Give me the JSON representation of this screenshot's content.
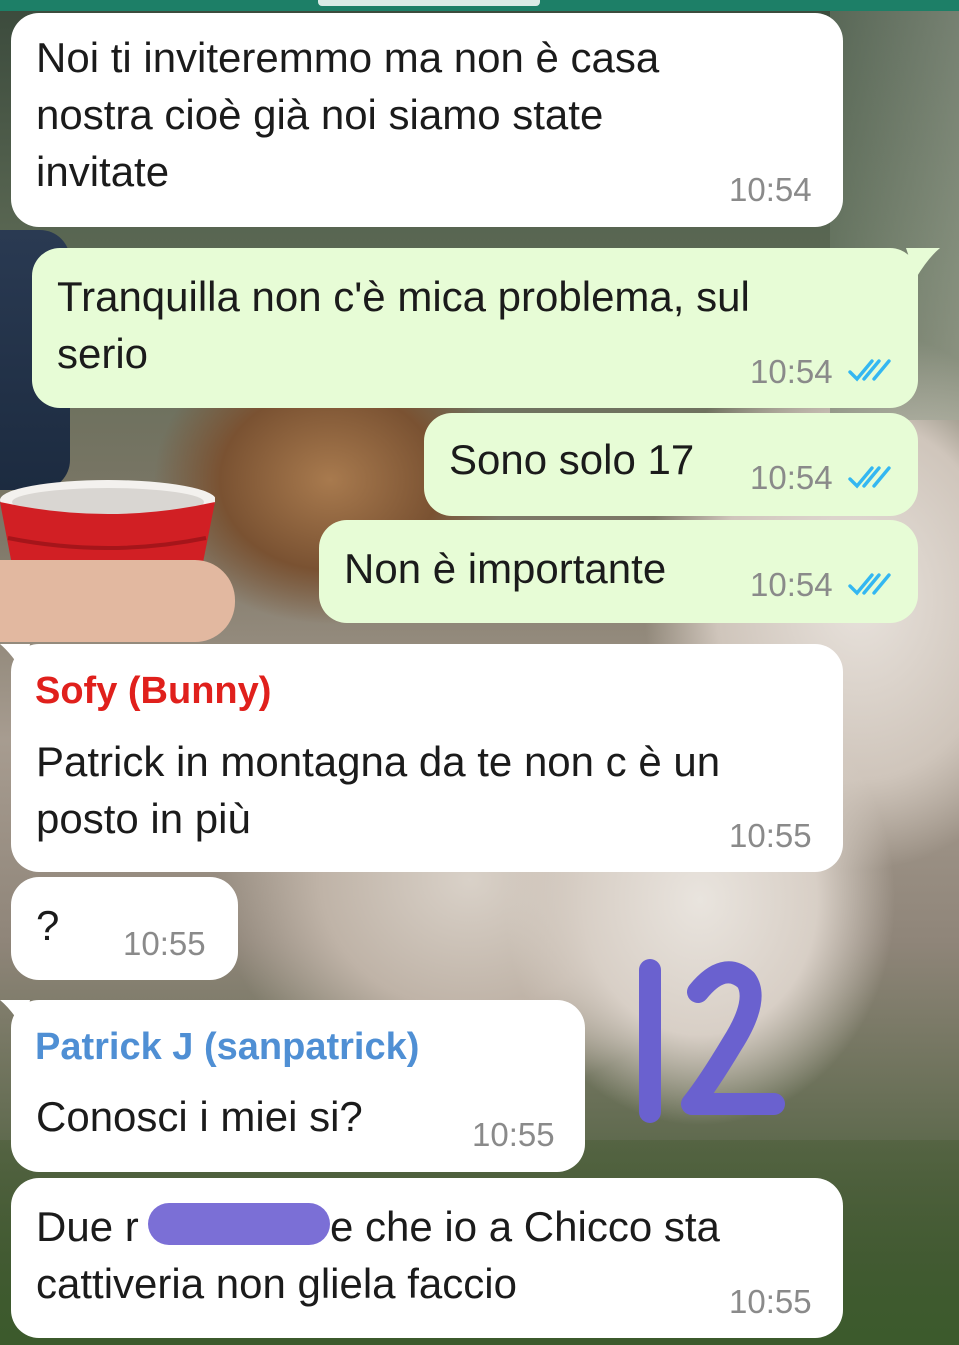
{
  "messages": [
    {
      "text_lines": [
        "Noi ti inviteremmo ma non è casa",
        "nostra cioè già noi siamo state",
        "invitate"
      ],
      "time": "10:54"
    },
    {
      "text_lines": [
        "Tranquilla non c'è mica problema, sul",
        "serio"
      ],
      "time": "10:54"
    },
    {
      "text": "Sono solo 17",
      "time": "10:54"
    },
    {
      "text": "Non è importante",
      "time": "10:54"
    },
    {
      "sender": "Sofy (Bunny)",
      "text_lines": [
        "Patrick in montagna da te non c è un",
        "posto in più"
      ],
      "time": "10:55"
    },
    {
      "text": "?",
      "time": "10:55"
    },
    {
      "sender": "Patrick J (sanpatrick)",
      "text": "Conosci i miei si?",
      "time": "10:55"
    },
    {
      "text_lines": [
        "Due r",
        "e che io a Chicco sta",
        "cattiveria non gliela faccio"
      ],
      "time": "10:55"
    }
  ],
  "annotation": "12",
  "colors": {
    "incoming_bubble": "#ffffff",
    "outgoing_bubble": "#e7fcd6",
    "sender_sofy": "#e0201c",
    "sender_patrick": "#4f8fd4",
    "read_ticks": "#34b7f1",
    "annotation": "#6a61cf",
    "header": "#1d7f67"
  },
  "icons": [
    "double-check-icon"
  ]
}
